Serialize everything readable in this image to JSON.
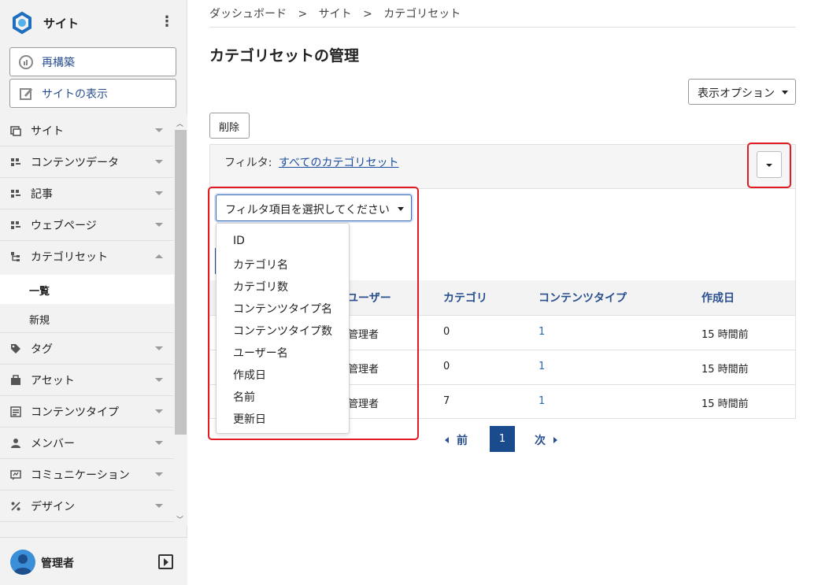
{
  "sidebar": {
    "site_name": "サイト",
    "rebuild_label": "再構築",
    "view_site_label": "サイトの表示",
    "items": [
      {
        "label": "サイト",
        "icon": "site-icon"
      },
      {
        "label": "コンテンツデータ",
        "icon": "content-data-icon"
      },
      {
        "label": "記事",
        "icon": "entry-icon"
      },
      {
        "label": "ウェブページ",
        "icon": "webpage-icon"
      },
      {
        "label": "カテゴリセット",
        "icon": "category-set-icon",
        "expanded": true
      },
      {
        "label": "タグ",
        "icon": "tag-icon"
      },
      {
        "label": "アセット",
        "icon": "asset-icon"
      },
      {
        "label": "コンテンツタイプ",
        "icon": "content-type-icon"
      },
      {
        "label": "メンバー",
        "icon": "member-icon"
      },
      {
        "label": "コミュニケーション",
        "icon": "communication-icon"
      },
      {
        "label": "デザイン",
        "icon": "design-icon"
      }
    ],
    "subitems": [
      {
        "label": "一覧",
        "active": true
      },
      {
        "label": "新規",
        "active": false
      }
    ],
    "user_name": "管理者"
  },
  "breadcrumb": [
    "ダッシュボード",
    ">",
    "サイト",
    ">",
    "カテゴリセット"
  ],
  "page_title": "カテゴリセットの管理",
  "display_options_label": "表示オプション",
  "delete_label": "削除",
  "filter": {
    "label": "フィルタ:",
    "link": "すべてのカテゴリセット",
    "select_label": "フィルタ項目を選択してください",
    "options": [
      "ID",
      "カテゴリ名",
      "カテゴリ数",
      "コンテンツタイプ名",
      "コンテンツタイプ数",
      "ユーザー名",
      "作成日",
      "名前",
      "更新日"
    ]
  },
  "table": {
    "headers": [
      "ユーザー",
      "カテゴリ",
      "コンテンツタイプ",
      "作成日"
    ],
    "rows": [
      [
        "管理者",
        "0",
        "1",
        "15 時間前"
      ],
      [
        "管理者",
        "0",
        "1",
        "15 時間前"
      ],
      [
        "管理者",
        "7",
        "1",
        "15 時間前"
      ]
    ]
  },
  "pagination": {
    "prev": "前",
    "current": "1",
    "next": "次"
  },
  "colors": {
    "accent": "#2a4f8f",
    "highlight": "#e01b24",
    "current_page": "#1a4b8c"
  }
}
